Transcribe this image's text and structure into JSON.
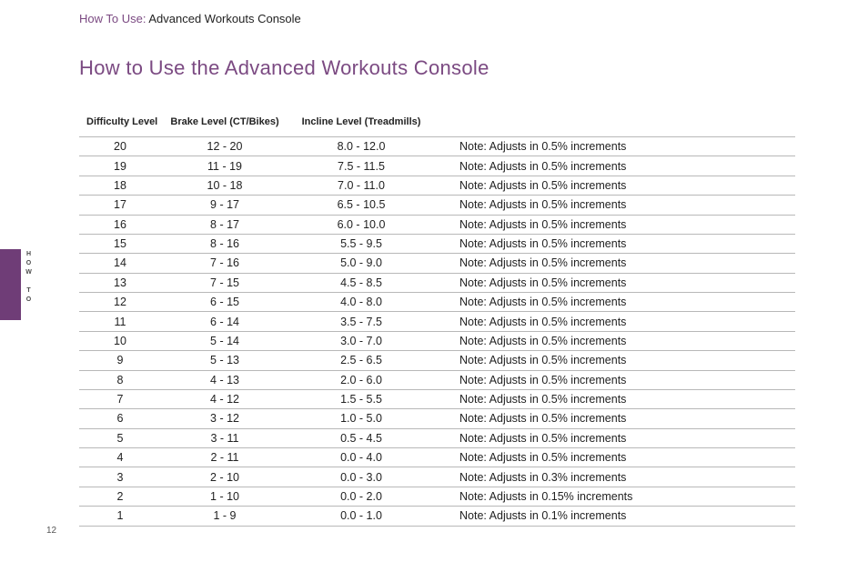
{
  "breadcrumb": {
    "prefix": "How To Use:",
    "suffix": " Advanced Workouts Console"
  },
  "heading": "How to Use the Advanced Workouts Console",
  "side_tab_label": "HOW TO",
  "page_number": "12",
  "table": {
    "headers": {
      "c1": "Difficulty Level",
      "c2": "Brake Level (CT/Bikes)",
      "c3": "Incline Level (Treadmills)",
      "c4": ""
    },
    "rows": [
      {
        "level": "20",
        "brake": "12 - 20",
        "incline": "8.0 - 12.0",
        "note": "Note: Adjusts in 0.5% increments"
      },
      {
        "level": "19",
        "brake": "11 - 19",
        "incline": "7.5 - 11.5",
        "note": "Note: Adjusts in 0.5% increments"
      },
      {
        "level": "18",
        "brake": "10 - 18",
        "incline": "7.0 - 11.0",
        "note": "Note: Adjusts in 0.5% increments"
      },
      {
        "level": "17",
        "brake": "9 - 17",
        "incline": "6.5 - 10.5",
        "note": "Note: Adjusts in 0.5% increments"
      },
      {
        "level": "16",
        "brake": "8 - 17",
        "incline": "6.0 - 10.0",
        "note": "Note: Adjusts in 0.5% increments"
      },
      {
        "level": "15",
        "brake": "8 - 16",
        "incline": "5.5 - 9.5",
        "note": "Note: Adjusts in 0.5% increments"
      },
      {
        "level": "14",
        "brake": "7 - 16",
        "incline": "5.0 - 9.0",
        "note": "Note: Adjusts in 0.5% increments"
      },
      {
        "level": "13",
        "brake": "7 - 15",
        "incline": "4.5 - 8.5",
        "note": "Note: Adjusts in 0.5% increments"
      },
      {
        "level": "12",
        "brake": "6 - 15",
        "incline": "4.0 - 8.0",
        "note": "Note: Adjusts in 0.5% increments"
      },
      {
        "level": "11",
        "brake": "6 - 14",
        "incline": "3.5 - 7.5",
        "note": "Note: Adjusts in 0.5% increments"
      },
      {
        "level": "10",
        "brake": "5 - 14",
        "incline": "3.0 - 7.0",
        "note": "Note: Adjusts in 0.5% increments"
      },
      {
        "level": "9",
        "brake": "5 - 13",
        "incline": "2.5 - 6.5",
        "note": "Note: Adjusts in 0.5% increments"
      },
      {
        "level": "8",
        "brake": "4 - 13",
        "incline": "2.0 - 6.0",
        "note": "Note: Adjusts in 0.5% increments"
      },
      {
        "level": "7",
        "brake": "4 - 12",
        "incline": "1.5 - 5.5",
        "note": "Note: Adjusts in 0.5% increments"
      },
      {
        "level": "6",
        "brake": "3 - 12",
        "incline": "1.0 - 5.0",
        "note": "Note: Adjusts in 0.5% increments"
      },
      {
        "level": "5",
        "brake": "3 - 11",
        "incline": "0.5 - 4.5",
        "note": "Note: Adjusts in 0.5% increments"
      },
      {
        "level": "4",
        "brake": "2 - 11",
        "incline": "0.0 - 4.0",
        "note": "Note: Adjusts in 0.5% increments"
      },
      {
        "level": "3",
        "brake": "2 - 10",
        "incline": "0.0 - 3.0",
        "note": "Note: Adjusts in 0.3% increments"
      },
      {
        "level": "2",
        "brake": "1 - 10",
        "incline": "0.0 - 2.0",
        "note": "Note: Adjusts in 0.15% increments"
      },
      {
        "level": "1",
        "brake": "1 - 9",
        "incline": "0.0 - 1.0",
        "note": "Note: Adjusts in 0.1% increments"
      }
    ]
  }
}
